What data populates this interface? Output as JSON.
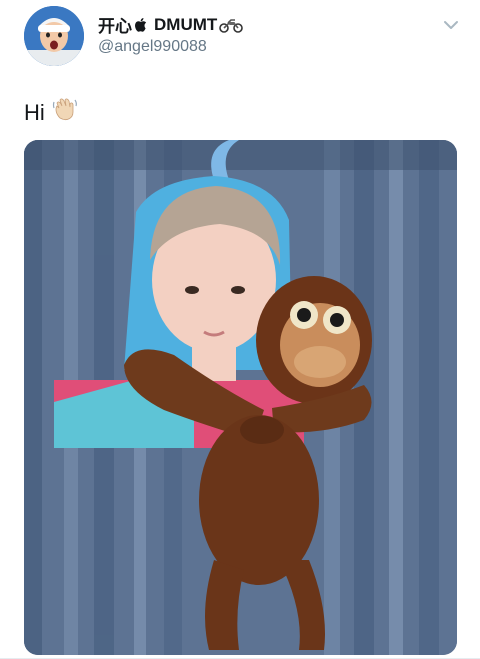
{
  "tweet": {
    "display_name": "开心",
    "display_name_suffix": "DMUMT",
    "handle": "@angel990088",
    "text": "Hi",
    "icons": {
      "avatar": "avatar",
      "name_prefix_icon": "apple-icon",
      "name_suffix_icon": "motorcycle-icon",
      "menu": "chevron-down-icon",
      "text_emoji": "waving-hand-icon"
    },
    "colors": {
      "name": "#14171a",
      "handle": "#657786",
      "chevron": "#aab8c2"
    }
  }
}
